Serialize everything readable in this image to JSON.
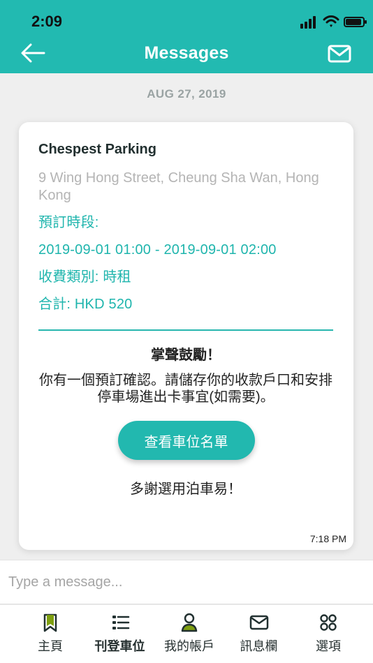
{
  "colors": {
    "primary": "#22bab1",
    "accent_text": "#1fb5ad",
    "background": "#efefef",
    "icon_active": "#7e9f10",
    "icon_teal": "#20b7ae",
    "dark": "#213030"
  },
  "status_bar": {
    "time": "2:09",
    "icons": [
      "signal-icon",
      "wifi-icon",
      "battery-icon"
    ]
  },
  "header": {
    "title": "Messages",
    "back_icon": "arrow-left-icon",
    "mail_icon": "mail-icon"
  },
  "conversation": {
    "date": "AUG 27, 2019",
    "message": {
      "parking_name": "Chespest Parking",
      "address": "9 Wing Hong Street, Cheung Sha Wan, Hong Kong",
      "booking_period_label": "預訂時段:",
      "booking_period_value": "2019-09-01 01:00 - 2019-09-01 02:00",
      "fee_type": "收費類別: 時租",
      "total": "合計: HKD 520",
      "congrats": "掌聲鼓勵！",
      "instruction": "你有一個預訂確認。請儲存你的收款戶口和安排停車場進出卡事宜(如需要)。",
      "button_label": "查看車位名單",
      "thanks": "多謝選用泊車易！",
      "timestamp": "7:18 PM"
    }
  },
  "composer": {
    "placeholder": "Type a message..."
  },
  "bottom_nav": {
    "items": [
      {
        "label": "主頁",
        "icon": "bookmark-icon"
      },
      {
        "label": "刊登車位",
        "icon": "list-icon",
        "active": true
      },
      {
        "label": "我的帳戶",
        "icon": "user-icon"
      },
      {
        "label": "訊息欄",
        "icon": "mail-icon"
      },
      {
        "label": "選項",
        "icon": "options-icon"
      }
    ]
  }
}
